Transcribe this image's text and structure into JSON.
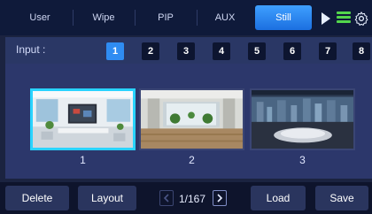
{
  "tabs": [
    {
      "label": "User",
      "active": false
    },
    {
      "label": "Wipe",
      "active": false
    },
    {
      "label": "PIP",
      "active": false
    },
    {
      "label": "AUX",
      "active": false
    },
    {
      "label": "Still",
      "active": true
    }
  ],
  "header_icons": [
    "play-icon",
    "list-icon",
    "gear-icon"
  ],
  "input": {
    "label": "Input :",
    "buttons": [
      "1",
      "2",
      "3",
      "4",
      "5",
      "6",
      "7",
      "8"
    ],
    "selected": "1"
  },
  "stills": [
    {
      "label": "1",
      "selected": true
    },
    {
      "label": "2",
      "selected": false
    },
    {
      "label": "3",
      "selected": false
    }
  ],
  "toolbar": {
    "delete_label": "Delete",
    "layout_label": "Layout",
    "page": "1/167",
    "load_label": "Load",
    "save_label": "Save"
  },
  "colors": {
    "accent": "#2f8cf2",
    "selected_border": "#29d3ff",
    "list_icon": "#53d64c"
  }
}
